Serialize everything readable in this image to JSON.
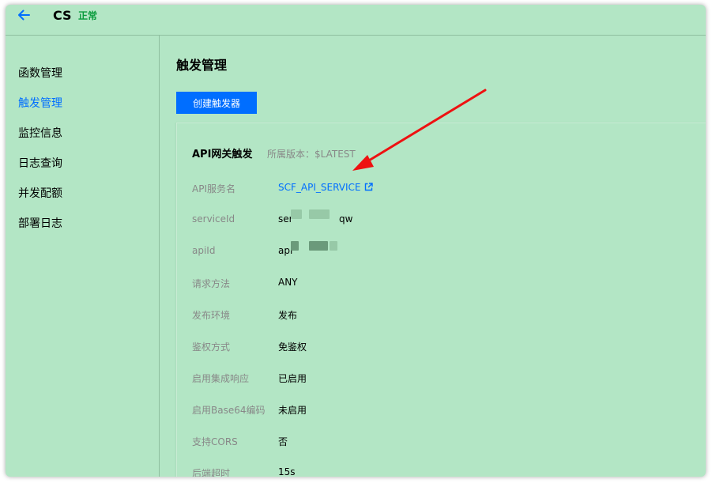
{
  "header": {
    "title": "CS",
    "status": "正常"
  },
  "sidebar": {
    "items": [
      {
        "label": "函数管理"
      },
      {
        "label": "触发管理"
      },
      {
        "label": "监控信息"
      },
      {
        "label": "日志查询"
      },
      {
        "label": "并发配额"
      },
      {
        "label": "部署日志"
      }
    ]
  },
  "main": {
    "page_title": "触发管理",
    "create_button": "创建触发器",
    "card": {
      "title": "API网关触发",
      "version": "所属版本：$LATEST",
      "rows": [
        {
          "label": "API服务名",
          "value": "SCF_API_SERVICE"
        },
        {
          "label": "serviceId",
          "value_start": "ser",
          "value_end": "qw"
        },
        {
          "label": "apiId",
          "value_start": "api",
          "value_end": ""
        },
        {
          "label": "请求方法",
          "value": "ANY"
        },
        {
          "label": "发布环境",
          "value": "发布"
        },
        {
          "label": "鉴权方式",
          "value": "免鉴权"
        },
        {
          "label": "启用集成响应",
          "value": "已启用"
        },
        {
          "label": "启用Base64编码",
          "value": "未启用"
        },
        {
          "label": "支持CORS",
          "value": "否"
        },
        {
          "label": "后端超时",
          "value": "15s"
        }
      ]
    }
  },
  "colors": {
    "background": "#b3e6c5",
    "accent": "#006eff",
    "status": "#0a9b3d",
    "annotation_arrow": "#ee1111"
  },
  "icons": {
    "back": "back-arrow-icon",
    "external_link": "external-link-icon"
  }
}
